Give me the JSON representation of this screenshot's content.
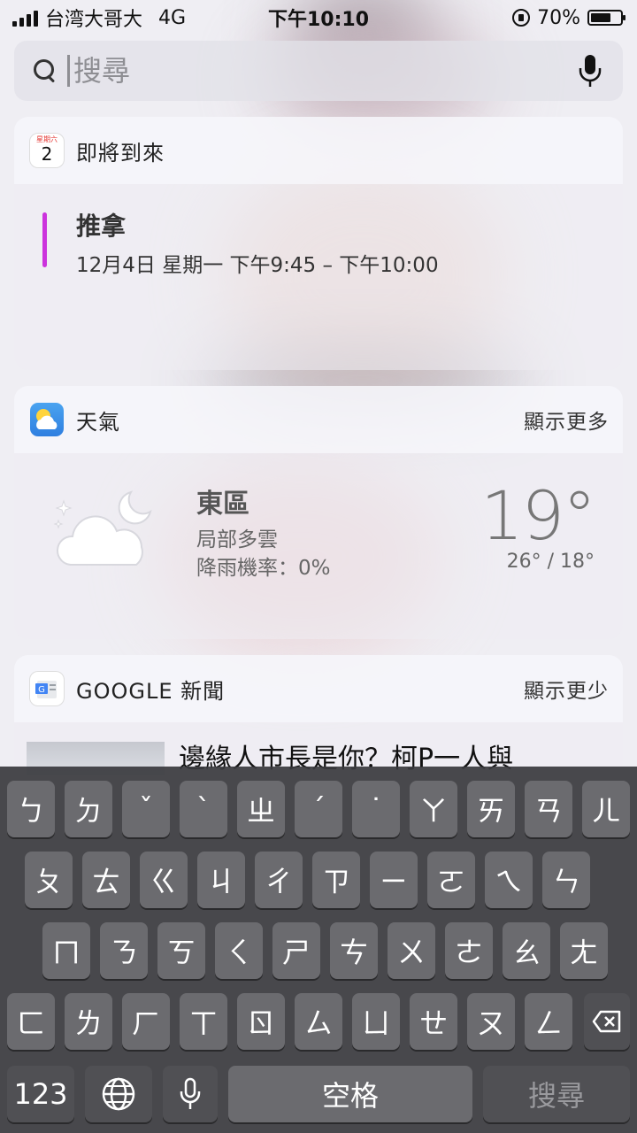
{
  "status_bar": {
    "carrier": "台湾大哥大",
    "network": "4G",
    "time": "下午10:10",
    "battery": "70%",
    "battery_level": 0.7
  },
  "search": {
    "placeholder": "搜尋",
    "value": ""
  },
  "calendar_widget": {
    "icon_day": "星期六",
    "icon_date": "2",
    "title": "即將到來",
    "event": {
      "title": "推拿",
      "time": "12月4日 星期一 下午9:45 – 下午10:00",
      "color": "#cc33dd"
    }
  },
  "weather_widget": {
    "title": "天氣",
    "action": "顯示更多",
    "location": "東區",
    "condition": "局部多雲",
    "rain_chance": "降雨機率：0%",
    "temperature": "19°",
    "high_low": "26° / 18°",
    "icon": "partly-cloudy-night-icon"
  },
  "news_widget": {
    "title": "GOOGLE 新聞",
    "action": "顯示更少",
    "headline": "邊緣人市長是你？柯P一人與"
  },
  "keyboard": {
    "row1": [
      "ㄅ",
      "ㄉ",
      "ˇ",
      "ˋ",
      "ㄓ",
      "ˊ",
      "˙",
      "ㄚ",
      "ㄞ",
      "ㄢ",
      "ㄦ"
    ],
    "row2": [
      "ㄆ",
      "ㄊ",
      "ㄍ",
      "ㄐ",
      "ㄔ",
      "ㄗ",
      "ㄧ",
      "ㄛ",
      "ㄟ",
      "ㄣ"
    ],
    "row3": [
      "ㄇ",
      "ㄋ",
      "ㄎ",
      "ㄑ",
      "ㄕ",
      "ㄘ",
      "ㄨ",
      "ㄜ",
      "ㄠ",
      "ㄤ"
    ],
    "row4": [
      "ㄈ",
      "ㄌ",
      "ㄏ",
      "ㄒ",
      "ㄖ",
      "ㄙ",
      "ㄩ",
      "ㄝ",
      "ㄡ",
      "ㄥ"
    ],
    "numbers_key": "123",
    "space_key": "空格",
    "search_key": "搜尋"
  }
}
